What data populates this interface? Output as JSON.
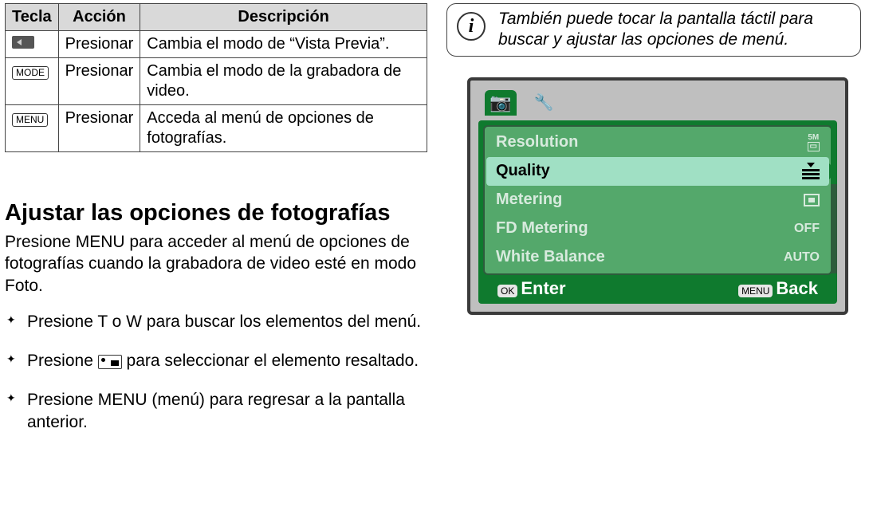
{
  "table": {
    "headers": {
      "h1": "Tecla",
      "h2": "Acción",
      "h3": "Descripción"
    },
    "rows": [
      {
        "key_icon": "playback",
        "action": "Presionar",
        "desc": "Cambia el modo de “Vista Previa”."
      },
      {
        "key_icon": "MODE",
        "action": "Presionar",
        "desc": "Cambia el modo de la grabadora de video."
      },
      {
        "key_icon": "MENU",
        "action": "Presionar",
        "desc": "Acceda al menú de opciones de fotografías."
      }
    ]
  },
  "section": {
    "title": "Ajustar las opciones de fotografías",
    "body": "Presione MENU para acceder al menú de opciones de fotografías cuando la grabadora de video esté en modo Foto.",
    "steps": [
      "Presione T o W para buscar los elementos del menú.",
      "Presione  para seleccionar el elemento resaltado.",
      "Presione MENU (menú) para regresar a la pantalla anterior."
    ],
    "step2_pre": "Presione ",
    "step2_post": " para seleccionar el elemento resaltado."
  },
  "infobox": {
    "text": "También puede tocar la pantalla táctil para buscar y ajustar las opciones de menú."
  },
  "camera_menu": {
    "rows": [
      {
        "label": "Resolution",
        "value": "5M"
      },
      {
        "label": "Quality",
        "value": ""
      },
      {
        "label": "Metering",
        "value": ""
      },
      {
        "label": "FD Metering",
        "value": "OFF"
      },
      {
        "label": "White Balance",
        "value": "AUTO"
      }
    ],
    "footer": {
      "ok": "OK",
      "enter": "Enter",
      "menu": "MENU",
      "back": "Back"
    }
  }
}
